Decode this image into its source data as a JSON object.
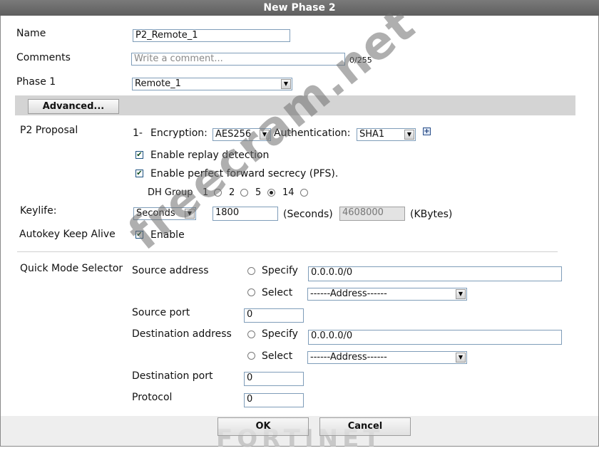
{
  "window": {
    "title": "New Phase 2"
  },
  "form": {
    "name_label": "Name",
    "name_value": "P2_Remote_1",
    "comments_label": "Comments",
    "comments_placeholder": "Write a comment...",
    "comments_counter": "0/255",
    "phase1_label": "Phase 1",
    "phase1_value": "Remote_1",
    "advanced_button": "Advanced..."
  },
  "proposal": {
    "label": "P2 Proposal",
    "index": "1-",
    "encryption_label": "Encryption:",
    "encryption_value": "AES256",
    "authentication_label": "Authentication:",
    "authentication_value": "SHA1",
    "replay_label": "Enable replay detection",
    "replay_checked": true,
    "pfs_label": "Enable perfect forward secrecy (PFS).",
    "pfs_checked": true,
    "dh_label": "DH Group",
    "dh_options": [
      "1",
      "2",
      "5",
      "14"
    ],
    "dh_selected": "14"
  },
  "keylife": {
    "label": "Keylife:",
    "type_value": "Seconds",
    "seconds_value": "1800",
    "seconds_unit": "(Seconds)",
    "kbytes_value": "4608000",
    "kbytes_unit": "(KBytes)"
  },
  "keepalive": {
    "label": "Autokey Keep Alive",
    "enable_label": "Enable",
    "checked": true
  },
  "selector": {
    "label": "Quick Mode Selector",
    "source_address_label": "Source address",
    "specify_label": "Specify",
    "select_label": "Select",
    "source_address_value": "0.0.0.0/0",
    "source_address_select": "------Address------",
    "source_port_label": "Source port",
    "source_port_value": "0",
    "destination_address_label": "Destination address",
    "destination_address_value": "0.0.0.0/0",
    "destination_address_select": "------Address------",
    "destination_port_label": "Destination port",
    "destination_port_value": "0",
    "protocol_label": "Protocol",
    "protocol_value": "0"
  },
  "footer": {
    "ok_button": "OK",
    "cancel_button": "Cancel",
    "brand": "FORTINET"
  },
  "watermark": {
    "text": "freecram.net"
  },
  "icons": {
    "checkbox_mark": "✔",
    "dropdown_arrow": "▼",
    "add_icon": "+"
  }
}
